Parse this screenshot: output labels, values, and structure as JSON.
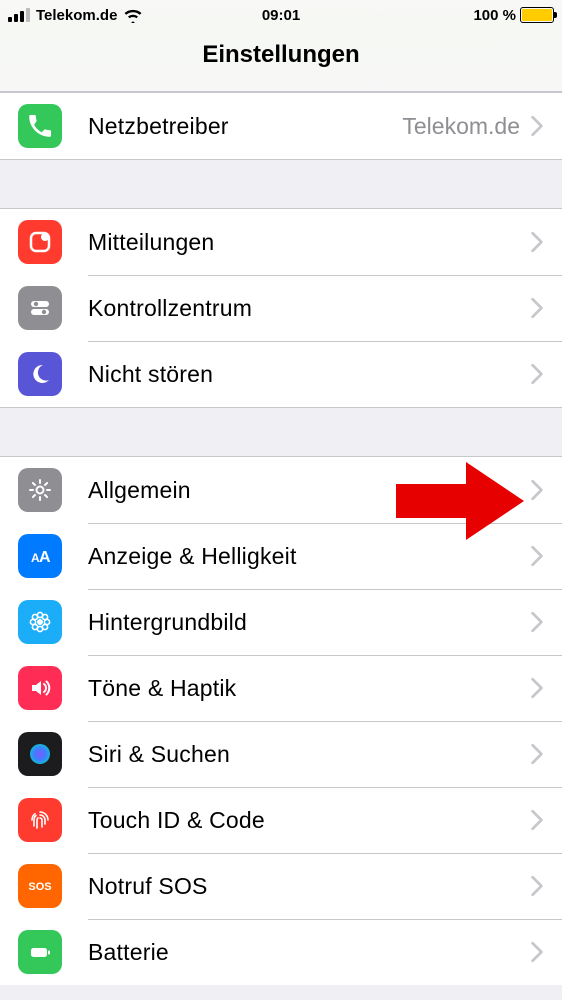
{
  "status": {
    "carrier": "Telekom.de",
    "time": "09:01",
    "battery_text": "100 %"
  },
  "nav": {
    "title": "Einstellungen"
  },
  "section_carrier": {
    "label": "Netzbetreiber",
    "value": "Telekom.de"
  },
  "section_a": {
    "items": [
      {
        "id": "notifications",
        "label": "Mitteilungen",
        "icon": "notifications-icon",
        "bg": "bg-red"
      },
      {
        "id": "control-center",
        "label": "Kontrollzentrum",
        "icon": "control-center-icon",
        "bg": "bg-grey"
      },
      {
        "id": "dnd",
        "label": "Nicht stören",
        "icon": "moon-icon",
        "bg": "bg-indigo"
      }
    ]
  },
  "section_b": {
    "items": [
      {
        "id": "general",
        "label": "Allgemein",
        "icon": "gear-icon",
        "bg": "bg-grey"
      },
      {
        "id": "display",
        "label": "Anzeige & Helligkeit",
        "icon": "textsize-icon",
        "bg": "bg-blue"
      },
      {
        "id": "wallpaper",
        "label": "Hintergrundbild",
        "icon": "flower-icon",
        "bg": "bg-cyan"
      },
      {
        "id": "sounds",
        "label": "Töne & Haptik",
        "icon": "speaker-icon",
        "bg": "bg-pink"
      },
      {
        "id": "siri",
        "label": "Siri & Suchen",
        "icon": "siri-icon",
        "bg": "bg-black"
      },
      {
        "id": "touchid",
        "label": "Touch ID & Code",
        "icon": "fingerprint-icon",
        "bg": "bg-red"
      },
      {
        "id": "sos",
        "label": "Notruf SOS",
        "icon": "sos-icon",
        "bg": "bg-orange"
      },
      {
        "id": "battery",
        "label": "Batterie",
        "icon": "battery-icon",
        "bg": "bg-green"
      }
    ]
  }
}
